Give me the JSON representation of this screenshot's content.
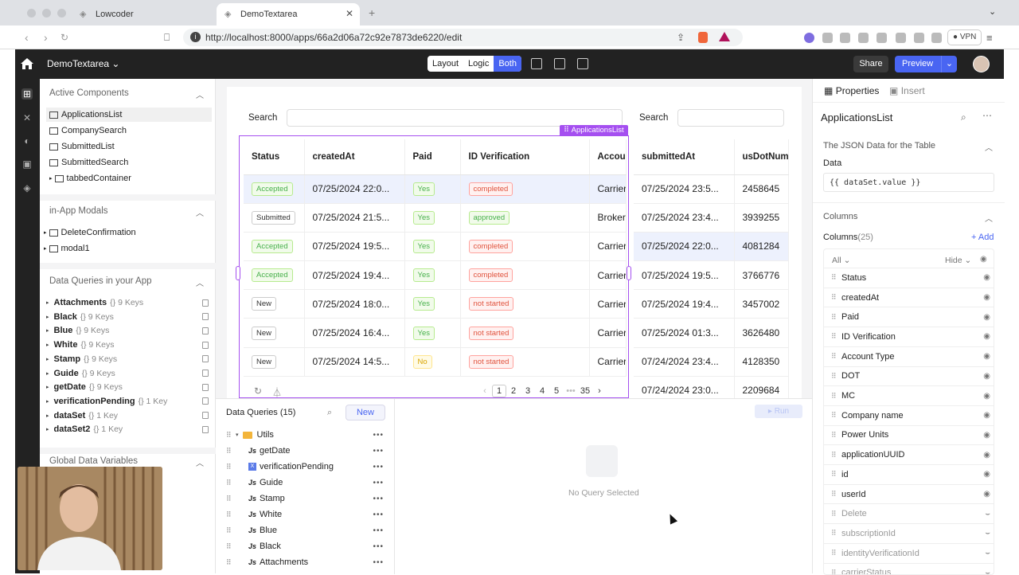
{
  "browser": {
    "tabs": [
      {
        "title": "Lowcoder",
        "active": false
      },
      {
        "title": "DemoTextarea",
        "active": true
      }
    ],
    "url": "http://localhost:8000/apps/66a2d06a72c92e7873de6220/edit",
    "vpn_label": "VPN"
  },
  "header": {
    "app_name": "DemoTextarea",
    "modes": [
      "Layout",
      "Logic",
      "Both"
    ],
    "active_mode": "Both",
    "share_label": "Share",
    "preview_label": "Preview"
  },
  "left": {
    "active_components_title": "Active Components",
    "components": [
      "ApplicationsList",
      "CompanySearch",
      "SubmittedList",
      "SubmittedSearch",
      "tabbedContainer"
    ],
    "modals_title": "in-App Modals",
    "modals": [
      "DeleteConfirmation",
      "modal1"
    ],
    "queries_title": "Data Queries in your App",
    "queries": [
      {
        "name": "Attachments",
        "meta": "{} 9 Keys"
      },
      {
        "name": "Black",
        "meta": "{} 9 Keys"
      },
      {
        "name": "Blue",
        "meta": "{} 9 Keys"
      },
      {
        "name": "White",
        "meta": "{} 9 Keys"
      },
      {
        "name": "Stamp",
        "meta": "{} 9 Keys"
      },
      {
        "name": "Guide",
        "meta": "{} 9 Keys"
      },
      {
        "name": "getDate",
        "meta": "{} 9 Keys"
      },
      {
        "name": "verificationPending",
        "meta": "{} 1 Key"
      },
      {
        "name": "dataSet",
        "meta": "{} 1 Key"
      },
      {
        "name": "dataSet2",
        "meta": "{} 1 Key"
      }
    ],
    "globals_title": "Global Data Variables"
  },
  "canvas": {
    "search1_label": "Search",
    "search2_label": "Search",
    "selected_component": "ApplicationsList",
    "table": {
      "columns": [
        "Status",
        "createdAt",
        "Paid",
        "ID Verification",
        "Accoun"
      ],
      "rows": [
        {
          "status": "Accepted",
          "status_style": "green",
          "createdAt": "07/25/2024 22:0...",
          "paid": "Yes",
          "paid_style": "green",
          "idv": "completed",
          "idv_style": "red",
          "account": "Carrier",
          "hl": true
        },
        {
          "status": "Submitted",
          "status_style": "gray",
          "createdAt": "07/25/2024 21:5...",
          "paid": "Yes",
          "paid_style": "green",
          "idv": "approved",
          "idv_style": "green",
          "account": "Broker",
          "hl": false
        },
        {
          "status": "Accepted",
          "status_style": "green",
          "createdAt": "07/25/2024 19:5...",
          "paid": "Yes",
          "paid_style": "green",
          "idv": "completed",
          "idv_style": "red",
          "account": "Carrier",
          "hl": false
        },
        {
          "status": "Accepted",
          "status_style": "green",
          "createdAt": "07/25/2024 19:4...",
          "paid": "Yes",
          "paid_style": "green",
          "idv": "completed",
          "idv_style": "red",
          "account": "Carrier",
          "hl": false
        },
        {
          "status": "New",
          "status_style": "gray",
          "createdAt": "07/25/2024 18:0...",
          "paid": "Yes",
          "paid_style": "green",
          "idv": "not started",
          "idv_style": "red",
          "account": "Carrier",
          "hl": false
        },
        {
          "status": "New",
          "status_style": "gray",
          "createdAt": "07/25/2024 16:4...",
          "paid": "Yes",
          "paid_style": "green",
          "idv": "not started",
          "idv_style": "red",
          "account": "Carrier",
          "hl": false
        },
        {
          "status": "New",
          "status_style": "gray",
          "createdAt": "07/25/2024 14:5...",
          "paid": "No",
          "paid_style": "yellow",
          "idv": "not started",
          "idv_style": "red",
          "account": "Carrier",
          "hl": false
        }
      ],
      "pages": [
        "1",
        "2",
        "3",
        "4",
        "5",
        "•••",
        "35"
      ]
    },
    "table2": {
      "columns": [
        "submittedAt",
        "usDotNum"
      ],
      "rows": [
        {
          "submittedAt": "07/25/2024 23:5...",
          "usdot": "2458645",
          "hl": false
        },
        {
          "submittedAt": "07/25/2024 23:4...",
          "usdot": "3939255",
          "hl": false
        },
        {
          "submittedAt": "07/25/2024 22:0...",
          "usdot": "4081284",
          "hl": true
        },
        {
          "submittedAt": "07/25/2024 19:5...",
          "usdot": "3766776",
          "hl": false
        },
        {
          "submittedAt": "07/25/2024 19:4...",
          "usdot": "3457002",
          "hl": false
        },
        {
          "submittedAt": "07/25/2024 01:3...",
          "usdot": "3626480",
          "hl": false
        },
        {
          "submittedAt": "07/24/2024 23:4...",
          "usdot": "4128350",
          "hl": false
        },
        {
          "submittedAt": "07/24/2024 23:0...",
          "usdot": "2209684",
          "hl": false
        }
      ]
    }
  },
  "bottom": {
    "title": "Data Queries (15)",
    "new_label": "New",
    "run_label": "Run",
    "folder": "Utils",
    "items": [
      {
        "name": "getDate",
        "kind": "js"
      },
      {
        "name": "verificationPending",
        "kind": "x"
      },
      {
        "name": "Guide",
        "kind": "js"
      },
      {
        "name": "Stamp",
        "kind": "js"
      },
      {
        "name": "White",
        "kind": "js"
      },
      {
        "name": "Blue",
        "kind": "js"
      },
      {
        "name": "Black",
        "kind": "js"
      },
      {
        "name": "Attachments",
        "kind": "js"
      }
    ],
    "empty_text": "No Query Selected"
  },
  "right": {
    "tab_properties": "Properties",
    "tab_insert": "Insert",
    "component_name": "ApplicationsList",
    "json_section": "The JSON Data for the Table",
    "data_label": "Data",
    "data_value": "{{ dataSet.value }}",
    "columns_section": "Columns",
    "columns_label": "Columns",
    "columns_count": "(25)",
    "add_label": "+ Add",
    "filter_all": "All",
    "filter_hide": "Hide",
    "columns": [
      {
        "name": "Status",
        "hidden": false
      },
      {
        "name": "createdAt",
        "hidden": false
      },
      {
        "name": "Paid",
        "hidden": false
      },
      {
        "name": "ID Verification",
        "hidden": false
      },
      {
        "name": "Account Type",
        "hidden": false
      },
      {
        "name": "DOT",
        "hidden": false
      },
      {
        "name": "MC",
        "hidden": false
      },
      {
        "name": "Company name",
        "hidden": false
      },
      {
        "name": "Power Units",
        "hidden": false
      },
      {
        "name": "applicationUUID",
        "hidden": false
      },
      {
        "name": "id",
        "hidden": false
      },
      {
        "name": "userId",
        "hidden": false
      },
      {
        "name": "Delete",
        "hidden": true
      },
      {
        "name": "subscriptionId",
        "hidden": true
      },
      {
        "name": "identityVerificationId",
        "hidden": true
      },
      {
        "name": "carrierStatus",
        "hidden": true
      }
    ]
  }
}
